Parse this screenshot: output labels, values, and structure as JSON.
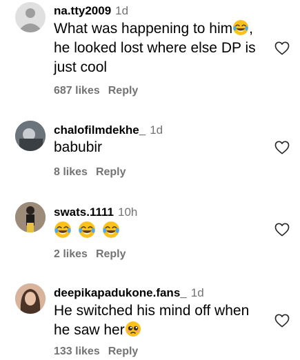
{
  "comments": [
    {
      "username": "na.tty2009",
      "time": "1d",
      "text_lines": [
        "What was happening to him",
        "he looked lost where else DP is",
        "just cool"
      ],
      "likes": "687 likes",
      "reply": "Reply"
    },
    {
      "username": "chalofilmdekhe_",
      "time": "1d",
      "text_lines": [
        "babubir"
      ],
      "likes": "8 likes",
      "reply": "Reply"
    },
    {
      "username": "swats.1111",
      "time": "10h",
      "text_lines": [],
      "likes": "2 likes",
      "reply": "Reply"
    },
    {
      "username": "deepikapadukone.fans_",
      "time": "1d",
      "text_lines": [
        "He switched his mind off when",
        "he saw her"
      ],
      "likes": "133 likes",
      "reply": "Reply"
    }
  ],
  "colors": {
    "secondary_text": "#737373",
    "heart_stroke": "#262626"
  },
  "icons": {
    "like": "heart-outline-icon",
    "default_avatar": "default-avatar-icon",
    "emoji_laugh": "face-with-tears-of-joy-icon",
    "emoji_plead": "pleading-face-icon"
  }
}
